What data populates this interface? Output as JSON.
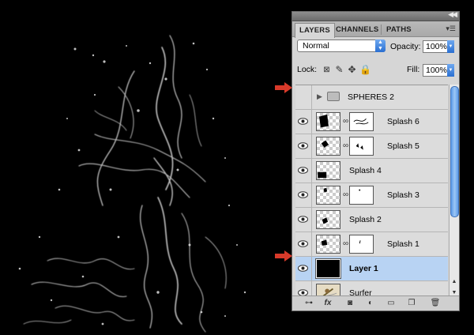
{
  "panel": {
    "tabs": [
      "LAYERS",
      "CHANNELS",
      "PATHS"
    ],
    "active_tab": "LAYERS",
    "blend_mode": "Normal",
    "opacity_label": "Opacity:",
    "opacity_value": "100%",
    "lock_label": "Lock:",
    "fill_label": "Fill:",
    "fill_value": "100%"
  },
  "layers": [
    {
      "name": "SPHERES 2",
      "type": "group",
      "visible": false
    },
    {
      "name": "Splash 6",
      "type": "layer",
      "visible": true,
      "mask": true
    },
    {
      "name": "Splash 5",
      "type": "layer",
      "visible": true,
      "mask": true
    },
    {
      "name": "Splash 4",
      "type": "layer",
      "visible": true,
      "mask": false
    },
    {
      "name": "Splash 3",
      "type": "layer",
      "visible": true,
      "mask": true
    },
    {
      "name": "Splash 2",
      "type": "layer",
      "visible": true,
      "mask": false
    },
    {
      "name": "Splash 1",
      "type": "layer",
      "visible": true,
      "mask": true
    },
    {
      "name": "Layer 1",
      "type": "layer",
      "visible": true,
      "mask": false,
      "selected": true
    },
    {
      "name": "Surfer",
      "type": "layer",
      "visible": true,
      "mask": false
    }
  ],
  "colors": {
    "accent": "#2a6fd1",
    "selection": "#b8d3f3",
    "arrow": "#d83a2a"
  }
}
